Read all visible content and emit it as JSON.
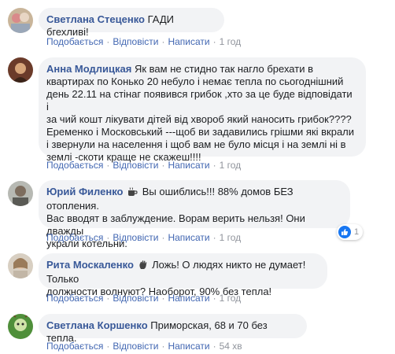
{
  "actions": {
    "like": "Подобається",
    "reply": "Відповісти",
    "write": "Написати"
  },
  "comments": [
    {
      "author": "Светлана Стеценко",
      "text": "ГАДИ бгехливі!",
      "time": "1 год"
    },
    {
      "author": "Анна Модлицкая",
      "lines": [
        " Як вам не стидно так нагло брехати в",
        "квартирах по Конько 20 небуло і немає тепла по сьогоднішний",
        "день 22.11 на стінаг появився грибок ,хто за це буде відповідати і",
        "за чий кошт лікувати дітей від хвороб який наносить грибок????",
        "Еременко і Московський ---щоб ви задавились грішми які вкрали",
        "і звернули на населення і щоб вам не було місця і на землі ні в",
        "землі -скоти краще не скажеш!!!!"
      ],
      "time": "1 год"
    },
    {
      "author": "Юрий Филенко",
      "author_icon": "coffee-cup-icon",
      "lines": [
        " Вы ошиблись!!! 88% домов БЕЗ отопления.",
        "Вас вводят в заблуждение. Ворам верить нельзя! Они дважды",
        "украли котельни."
      ],
      "time": "1 год",
      "reaction": {
        "icon": "like-icon",
        "count": "1",
        "color": "#1877f2"
      }
    },
    {
      "author": "Рита Москаленко",
      "author_icon": "waving-hand-icon",
      "lines": [
        " Ложь! О людях никто не думает! Только",
        "должности волнуют? Наоборот, 90% без тепла!"
      ],
      "time": "1 год"
    },
    {
      "author": "Светлана Коршенко",
      "text": "Приморская, 68 и 70 без тепла.",
      "time": "54 хв"
    }
  ]
}
